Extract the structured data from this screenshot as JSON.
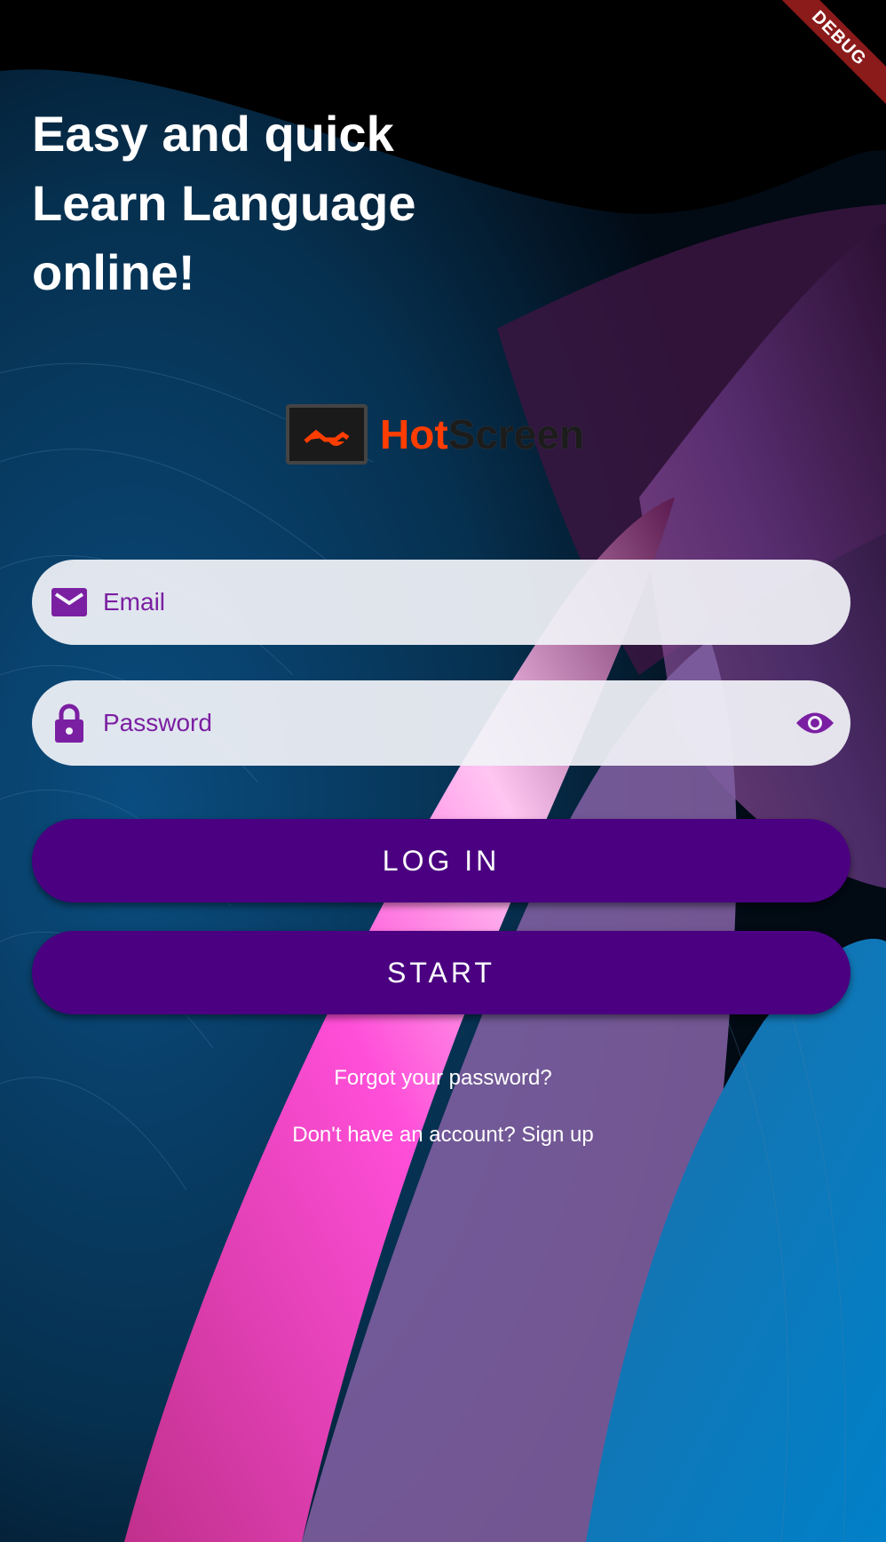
{
  "debug_banner": "DEBUG",
  "headline": [
    "Easy and quick",
    "Learn Language",
    "online!"
  ],
  "logo": {
    "part1": "Hot",
    "part2": "Screen"
  },
  "email_field": {
    "placeholder": "Email",
    "icon": "mail-icon"
  },
  "password_field": {
    "placeholder": "Password",
    "icon": "lock-icon",
    "toggle_icon": "eye-icon"
  },
  "login_button": "LOG IN",
  "start_button": "START",
  "forgot_password": "Forgot your password?",
  "signup_link": "Don't have an account? Sign up",
  "colors": {
    "accent": "#7b1fa2",
    "button": "#4a0080",
    "field_bg": "#f1f2f8",
    "logo_orange": "#ff3d00"
  }
}
